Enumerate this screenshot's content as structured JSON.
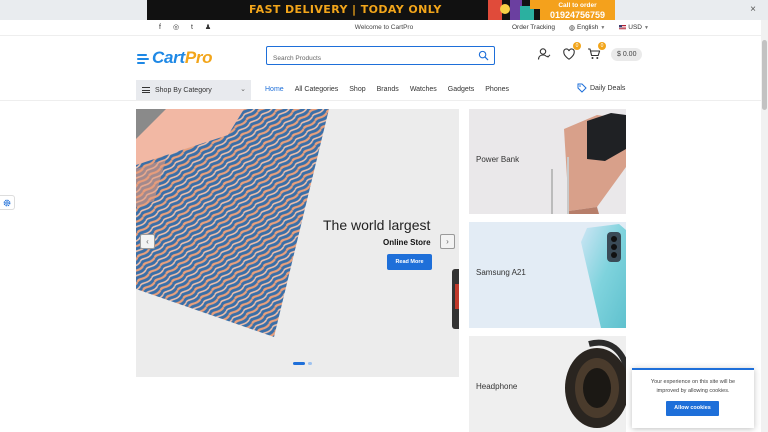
{
  "promo": {
    "headline": "FAST DELIVERY | TODAY ONLY",
    "cta_line1": "Call to order",
    "cta_line2": "01924756759",
    "close": "×"
  },
  "topbar": {
    "social": [
      "f",
      "◎",
      "t",
      "♟"
    ],
    "welcome": "Welcome to CartPro",
    "order_tracking": "Order Tracking",
    "language": "English",
    "currency": "USD"
  },
  "header": {
    "logo_a": "Cart",
    "logo_b": "Pro",
    "search_placeholder": "Search Products",
    "wishlist_count": "0",
    "cart_count": "0",
    "cart_total": "$ 0.00"
  },
  "nav": {
    "category_label": "Shop By Category",
    "items": [
      "Home",
      "All Categories",
      "Shop",
      "Brands",
      "Watches",
      "Gadgets",
      "Phones"
    ],
    "active": "Home",
    "deals_label": "Daily Deals"
  },
  "hero": {
    "title": "The world largest",
    "subtitle": "Online Store",
    "button": "Read More",
    "prev": "‹",
    "next": "›",
    "slides": 2,
    "current_slide": 1
  },
  "side_banners": [
    {
      "label": "Power Bank"
    },
    {
      "label": "Samsung A21"
    },
    {
      "label": "Headphone"
    }
  ],
  "cookie": {
    "text": "Your experience on this site will be improved by allowing cookies.",
    "button": "Allow cookies"
  },
  "colors": {
    "accent": "#1e6fd9",
    "brand_orange": "#f2a51a"
  }
}
